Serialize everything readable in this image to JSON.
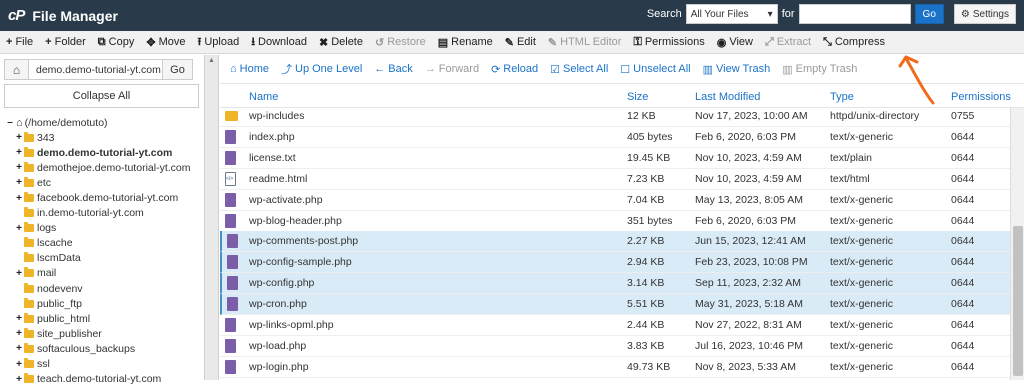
{
  "header": {
    "logo": "cP",
    "title": "File Manager",
    "search_label": "Search",
    "search_scope": "All Your Files",
    "for_label": "for",
    "search_value": "",
    "go_label": "Go",
    "settings_label": "Settings"
  },
  "toolbar": [
    {
      "icon": "plus-icon",
      "glyph": "+",
      "label": "File",
      "disabled": false
    },
    {
      "icon": "plus-icon",
      "glyph": "+",
      "label": "Folder",
      "disabled": false
    },
    {
      "icon": "copy-icon",
      "glyph": "⧉",
      "label": "Copy",
      "disabled": false
    },
    {
      "icon": "move-icon",
      "glyph": "✥",
      "label": "Move",
      "disabled": false
    },
    {
      "icon": "upload-icon",
      "glyph": "⭱",
      "label": "Upload",
      "disabled": false
    },
    {
      "icon": "download-icon",
      "glyph": "⭳",
      "label": "Download",
      "disabled": false
    },
    {
      "icon": "close-icon",
      "glyph": "✖",
      "label": "Delete",
      "disabled": false
    },
    {
      "icon": "undo-icon",
      "glyph": "↺",
      "label": "Restore",
      "disabled": true
    },
    {
      "icon": "file-icon",
      "glyph": "▤",
      "label": "Rename",
      "disabled": false
    },
    {
      "icon": "pencil-icon",
      "glyph": "✎",
      "label": "Edit",
      "disabled": false
    },
    {
      "icon": "pencil-icon",
      "glyph": "✎",
      "label": "HTML Editor",
      "disabled": true
    },
    {
      "icon": "key-icon",
      "glyph": "⚿",
      "label": "Permissions",
      "disabled": false
    },
    {
      "icon": "eye-icon",
      "glyph": "◉",
      "label": "View",
      "disabled": false
    },
    {
      "icon": "expand-icon",
      "glyph": "⤢",
      "label": "Extract",
      "disabled": true
    },
    {
      "icon": "compress-icon",
      "glyph": "⤡",
      "label": "Compress",
      "disabled": false
    }
  ],
  "sidebar": {
    "path_value": "demo.demo-tutorial-yt.com",
    "go_label": "Go",
    "collapse_label": "Collapse All",
    "tree": [
      {
        "label": "(/home/demotuto)",
        "expander": "–",
        "indent": 0,
        "bold": false,
        "root": true
      },
      {
        "label": "343",
        "expander": "+",
        "indent": 1,
        "bold": false
      },
      {
        "label": "demo.demo-tutorial-yt.com",
        "expander": "+",
        "indent": 1,
        "bold": true
      },
      {
        "label": "demothejoe.demo-tutorial-yt.com",
        "expander": "+",
        "indent": 1,
        "bold": false
      },
      {
        "label": "etc",
        "expander": "+",
        "indent": 1,
        "bold": false
      },
      {
        "label": "facebook.demo-tutorial-yt.com",
        "expander": "+",
        "indent": 1,
        "bold": false
      },
      {
        "label": "in.demo-tutorial-yt.com",
        "expander": "",
        "indent": 1,
        "bold": false
      },
      {
        "label": "logs",
        "expander": "+",
        "indent": 1,
        "bold": false
      },
      {
        "label": "lscache",
        "expander": "",
        "indent": 1,
        "bold": false
      },
      {
        "label": "lscmData",
        "expander": "",
        "indent": 1,
        "bold": false
      },
      {
        "label": "mail",
        "expander": "+",
        "indent": 1,
        "bold": false
      },
      {
        "label": "nodevenv",
        "expander": "",
        "indent": 1,
        "bold": false
      },
      {
        "label": "public_ftp",
        "expander": "",
        "indent": 1,
        "bold": false
      },
      {
        "label": "public_html",
        "expander": "+",
        "indent": 1,
        "bold": false
      },
      {
        "label": "site_publisher",
        "expander": "+",
        "indent": 1,
        "bold": false
      },
      {
        "label": "softaculous_backups",
        "expander": "+",
        "indent": 1,
        "bold": false
      },
      {
        "label": "ssl",
        "expander": "+",
        "indent": 1,
        "bold": false
      },
      {
        "label": "teach.demo-tutorial-yt.com",
        "expander": "+",
        "indent": 1,
        "bold": false
      }
    ]
  },
  "actions": [
    {
      "icon": "home-icon",
      "glyph": "⌂",
      "label": "Home",
      "disabled": false
    },
    {
      "icon": "level-up-icon",
      "glyph": "⤴",
      "label": "Up One Level",
      "disabled": false
    },
    {
      "icon": "arrow-left-icon",
      "glyph": "←",
      "label": "Back",
      "disabled": false
    },
    {
      "icon": "arrow-right-icon",
      "glyph": "→",
      "label": "Forward",
      "disabled": true
    },
    {
      "icon": "reload-icon",
      "glyph": "⟳",
      "label": "Reload",
      "disabled": false
    },
    {
      "icon": "check-square-icon",
      "glyph": "☑",
      "label": "Select All",
      "disabled": false
    },
    {
      "icon": "square-icon",
      "glyph": "☐",
      "label": "Unselect All",
      "disabled": false
    },
    {
      "icon": "trash-icon",
      "glyph": "▥",
      "label": "View Trash",
      "disabled": false
    },
    {
      "icon": "trash-icon",
      "glyph": "▥",
      "label": "Empty Trash",
      "disabled": true
    }
  ],
  "table": {
    "columns": [
      "Name",
      "Size",
      "Last Modified",
      "Type",
      "Permissions"
    ],
    "rows": [
      {
        "name": "wp-includes",
        "size": "12 KB",
        "modified": "Nov 17, 2023, 10:00 AM",
        "type": "httpd/unix-directory",
        "perms": "0755",
        "icon": "folder",
        "selected": false
      },
      {
        "name": "index.php",
        "size": "405 bytes",
        "modified": "Feb 6, 2020, 6:03 PM",
        "type": "text/x-generic",
        "perms": "0644",
        "icon": "file",
        "selected": false
      },
      {
        "name": "license.txt",
        "size": "19.45 KB",
        "modified": "Nov 10, 2023, 4:59 AM",
        "type": "text/plain",
        "perms": "0644",
        "icon": "file",
        "selected": false
      },
      {
        "name": "readme.html",
        "size": "7.23 KB",
        "modified": "Nov 10, 2023, 4:59 AM",
        "type": "text/html",
        "perms": "0644",
        "icon": "html",
        "selected": false
      },
      {
        "name": "wp-activate.php",
        "size": "7.04 KB",
        "modified": "May 13, 2023, 8:05 AM",
        "type": "text/x-generic",
        "perms": "0644",
        "icon": "file",
        "selected": false
      },
      {
        "name": "wp-blog-header.php",
        "size": "351 bytes",
        "modified": "Feb 6, 2020, 6:03 PM",
        "type": "text/x-generic",
        "perms": "0644",
        "icon": "file",
        "selected": false
      },
      {
        "name": "wp-comments-post.php",
        "size": "2.27 KB",
        "modified": "Jun 15, 2023, 12:41 AM",
        "type": "text/x-generic",
        "perms": "0644",
        "icon": "file",
        "selected": true
      },
      {
        "name": "wp-config-sample.php",
        "size": "2.94 KB",
        "modified": "Feb 23, 2023, 10:08 PM",
        "type": "text/x-generic",
        "perms": "0644",
        "icon": "file",
        "selected": true
      },
      {
        "name": "wp-config.php",
        "size": "3.14 KB",
        "modified": "Sep 11, 2023, 2:32 AM",
        "type": "text/x-generic",
        "perms": "0644",
        "icon": "file",
        "selected": true
      },
      {
        "name": "wp-cron.php",
        "size": "5.51 KB",
        "modified": "May 31, 2023, 5:18 AM",
        "type": "text/x-generic",
        "perms": "0644",
        "icon": "file",
        "selected": true
      },
      {
        "name": "wp-links-opml.php",
        "size": "2.44 KB",
        "modified": "Nov 27, 2022, 8:31 AM",
        "type": "text/x-generic",
        "perms": "0644",
        "icon": "file",
        "selected": false
      },
      {
        "name": "wp-load.php",
        "size": "3.83 KB",
        "modified": "Jul 16, 2023, 10:46 PM",
        "type": "text/x-generic",
        "perms": "0644",
        "icon": "file",
        "selected": false
      },
      {
        "name": "wp-login.php",
        "size": "49.73 KB",
        "modified": "Nov 8, 2023, 5:33 AM",
        "type": "text/x-generic",
        "perms": "0644",
        "icon": "file",
        "selected": false
      }
    ]
  },
  "colors": {
    "header_bg": "#293a4a",
    "link_blue": "#1b73c9",
    "selected_row": "#d9ebf7",
    "annotation_orange": "#f26b1d"
  }
}
